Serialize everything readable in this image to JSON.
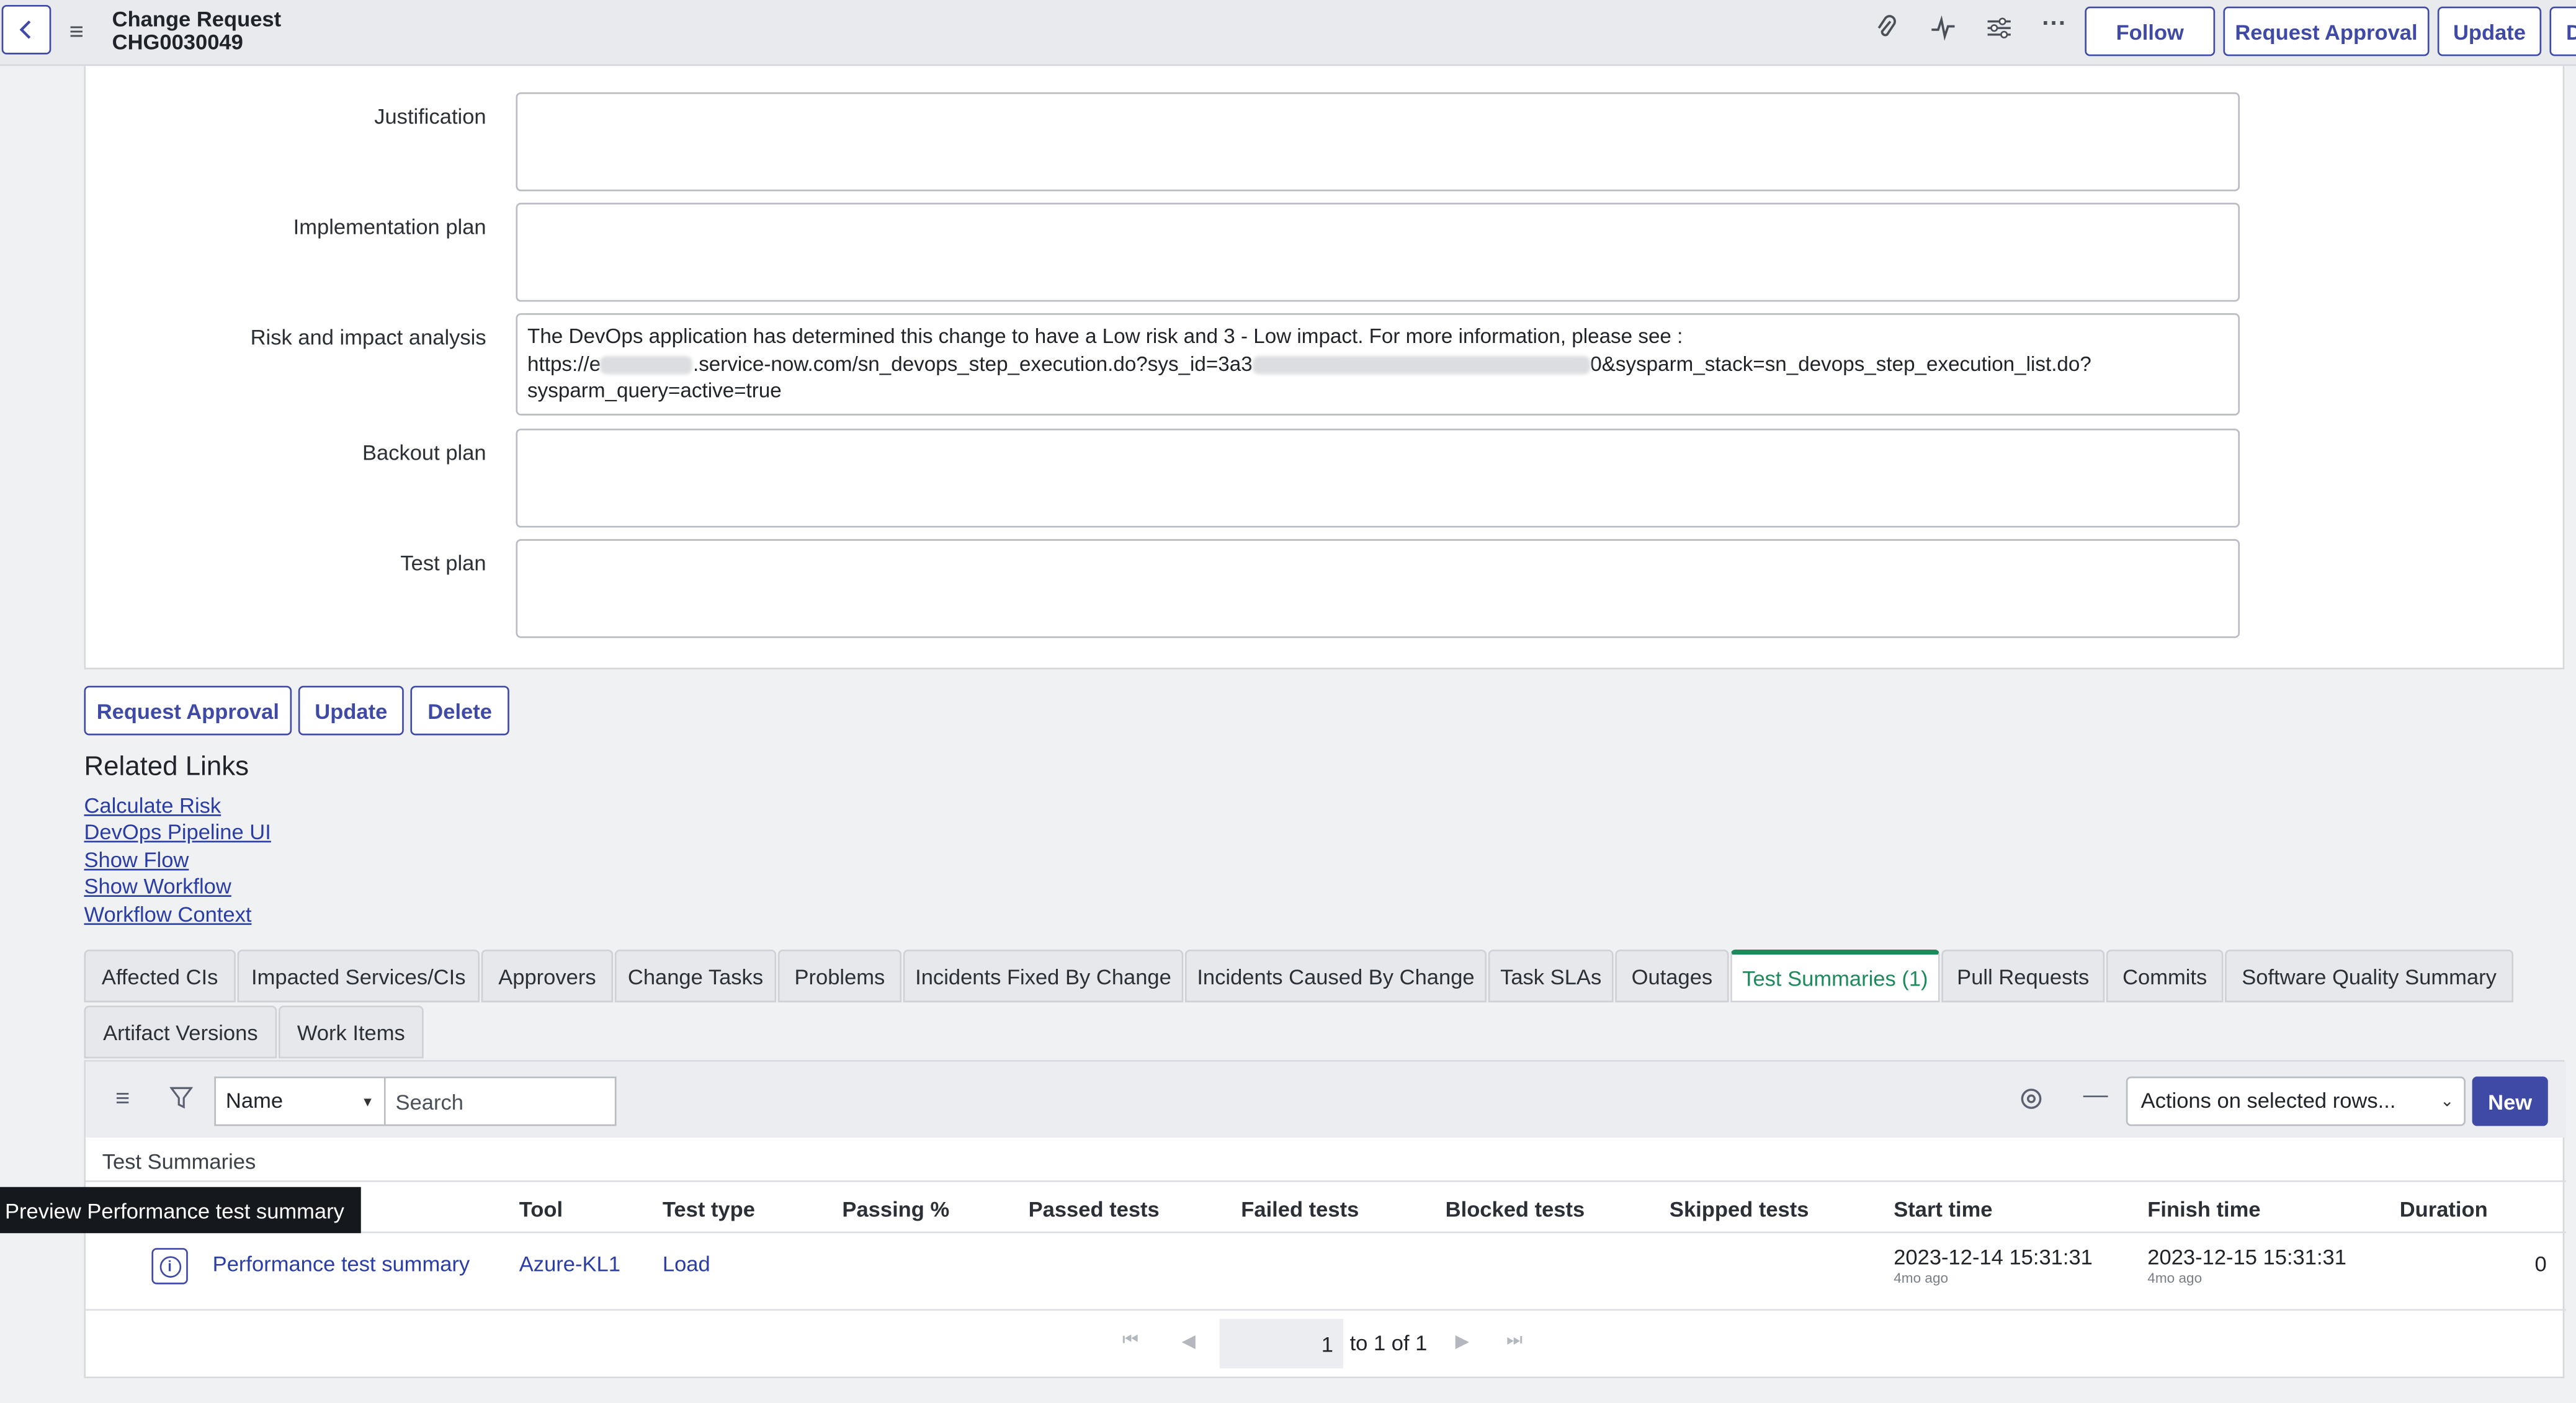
{
  "header": {
    "record_type": "Change Request",
    "record_number": "CHG0030049",
    "buttons": {
      "follow": "Follow",
      "request_approval": "Request Approval",
      "update": "Update",
      "delete_partial": "D"
    }
  },
  "form": {
    "fields": [
      {
        "label": "Justification",
        "value": ""
      },
      {
        "label": "Implementation plan",
        "value": ""
      },
      {
        "label": "Risk and impact analysis",
        "value_line1": "The DevOps application has determined this change to have a Low risk and 3 - Low impact. For more information, please see :",
        "value_line2a": "https://e",
        "value_line2b": ".service-now.com/sn_devops_step_execution.do?sys_id=3a3",
        "value_line2c": "0&sysparm_stack=sn_devops_step_execution_list.do?",
        "value_line3": "sysparm_query=active=true"
      },
      {
        "label": "Backout plan",
        "value": ""
      },
      {
        "label": "Test plan",
        "value": ""
      }
    ],
    "buttons": {
      "request_approval": "Request Approval",
      "update": "Update",
      "delete": "Delete"
    }
  },
  "related_links": {
    "title": "Related Links",
    "items": [
      "Calculate Risk",
      "DevOps Pipeline UI",
      "Show Flow",
      "Show Workflow",
      "Workflow Context"
    ]
  },
  "tabs": [
    "Affected CIs",
    "Impacted Services/CIs",
    "Approvers",
    "Change Tasks",
    "Problems",
    "Incidents Fixed By Change",
    "Incidents Caused By Change",
    "Task SLAs",
    "Outages",
    "Test Summaries (1)",
    "Pull Requests",
    "Commits",
    "Software Quality Summary",
    "Artifact Versions",
    "Work Items"
  ],
  "active_tab": "Test Summaries (1)",
  "list": {
    "filter_field": "Name",
    "search_placeholder": "Search",
    "actions_label": "Actions on selected rows...",
    "new_label": "New",
    "caption": "Test Summaries",
    "columns": [
      "Tool",
      "Test type",
      "Passing %",
      "Passed tests",
      "Failed tests",
      "Blocked tests",
      "Skipped tests",
      "Start time",
      "Finish time",
      "Duration"
    ],
    "row": {
      "name": "Performance test summary",
      "tool": "Azure-KL1",
      "test_type": "Load",
      "start_time": "2023-12-14 15:31:31",
      "start_relative": "4mo ago",
      "finish_time": "2023-12-15 15:31:31",
      "finish_relative": "4mo ago",
      "duration": "0"
    },
    "pager": {
      "page": "1",
      "of_text": "to 1 of 1"
    }
  },
  "tooltip": "Preview Performance test summary"
}
